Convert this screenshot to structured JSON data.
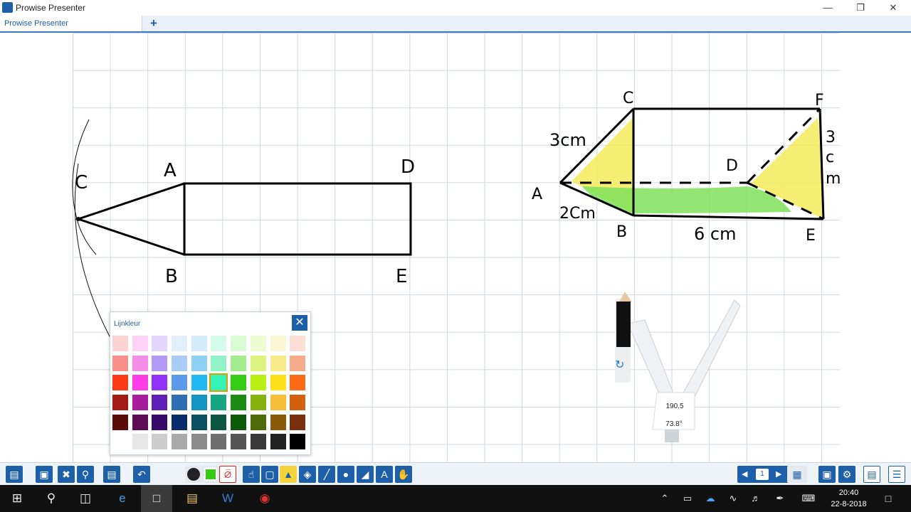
{
  "window": {
    "title": "Prowise Presenter"
  },
  "tabs": [
    {
      "label": "Prowise Presenter"
    }
  ],
  "drawing": {
    "left_labels": {
      "a": "A",
      "b": "B",
      "c": "C",
      "d": "D",
      "e": "E"
    },
    "right_labels": {
      "a": "A",
      "b": "B",
      "c": "C",
      "d": "D",
      "e": "E",
      "f": "F",
      "three_cm": "3cm",
      "two_cm": "2Cm",
      "six_cm": "6 cm",
      "side_three": "3",
      "side_c": "c",
      "side_m": "m"
    },
    "compass": {
      "radius": "190.5",
      "angle": "73.8°"
    }
  },
  "palette": {
    "title": "Lijnkleur",
    "selected_index": 25,
    "swatches": [
      "#fcd3d3",
      "#fcd3f6",
      "#e4d3fb",
      "#e3eefb",
      "#d3ecfb",
      "#d4fbe9",
      "#d9fbd3",
      "#eefbd0",
      "#fbf6d3",
      "#fbded4",
      "#f7908b",
      "#f58ee8",
      "#b09af6",
      "#a9cbf5",
      "#8ed1f5",
      "#92f2c8",
      "#a3ed90",
      "#ddf27f",
      "#f8e98a",
      "#f6a98b",
      "#fc3c17",
      "#fc3ce6",
      "#9032fc",
      "#5b99ea",
      "#22b8f5",
      "#33f2b6",
      "#36cc15",
      "#b9ef12",
      "#ffe11a",
      "#fc6a15",
      "#a51c14",
      "#a81c9e",
      "#6120b5",
      "#2c6fb3",
      "#1295c2",
      "#18a785",
      "#1e8c14",
      "#84b30f",
      "#f7bd39",
      "#d45f0f",
      "#5c0d0a",
      "#5c0d55",
      "#360c68",
      "#0b2c6b",
      "#0b4f60",
      "#0e5843",
      "#0d5a0a",
      "#4f6b09",
      "#8a5a0b",
      "#7a300b",
      "#ffffff",
      "#e7e7e7",
      "#cccccc",
      "#aaaaaa",
      "#8c8c8c",
      "#6f6f6f",
      "#555555",
      "#3a3a3a",
      "#222222",
      "#000000"
    ]
  },
  "toolbar": {
    "page_number": "1",
    "icons": [
      "folder-icon",
      "screenshot-icon",
      "tools-icon",
      "zoom-icon",
      "pages-icon",
      "undo-icon",
      "line-color-icon",
      "fill-color-icon",
      "no-fill-icon",
      "select-icon",
      "crop-icon",
      "marker-icon",
      "eraser-icon",
      "line-icon",
      "shape-icon",
      "ruler-icon",
      "text-icon",
      "hand-icon",
      "prev-page-icon",
      "next-page-icon",
      "page-grid-icon",
      "fullscreen-icon",
      "settings-icon",
      "presenter-icon",
      "menu-icon"
    ]
  },
  "taskbar": {
    "time": "20:40",
    "date": "22-8-2018"
  }
}
